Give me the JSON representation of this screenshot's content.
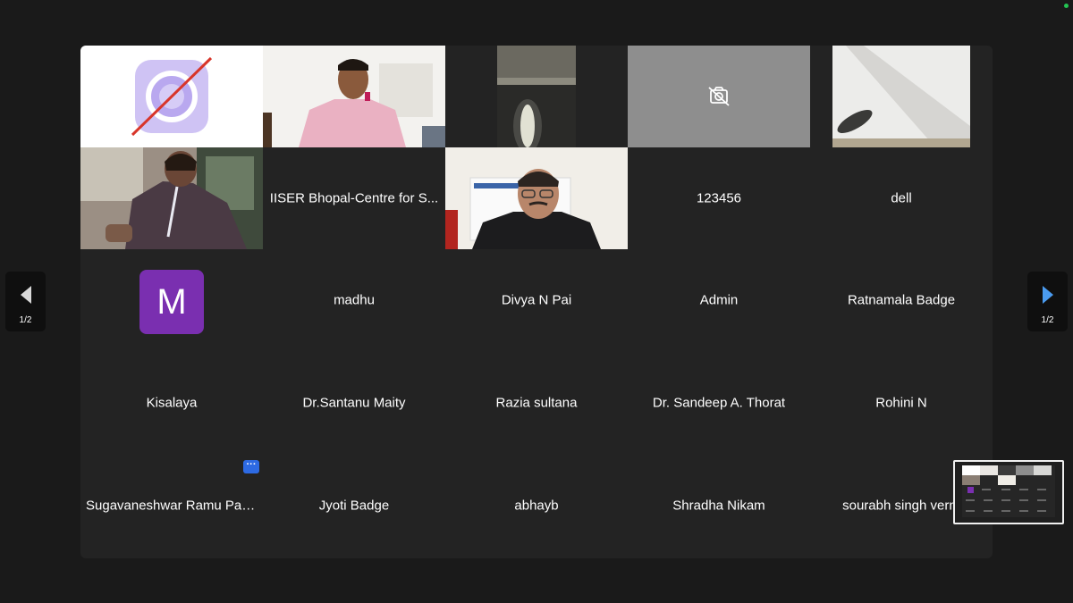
{
  "participants": [
    {
      "name": ""
    },
    {
      "name": ""
    },
    {
      "name": ""
    },
    {
      "name": ""
    },
    {
      "name": ""
    },
    {
      "name": ""
    },
    {
      "name": "IISER Bhopal-Centre for S..."
    },
    {
      "name": ""
    },
    {
      "name": "123456"
    },
    {
      "name": "dell"
    },
    {
      "name": "",
      "avatar_letter": "M"
    },
    {
      "name": "madhu"
    },
    {
      "name": "Divya N Pai"
    },
    {
      "name": "Admin"
    },
    {
      "name": "Ratnamala Badge"
    },
    {
      "name": "Kisalaya"
    },
    {
      "name": "Dr.Santanu Maity"
    },
    {
      "name": "Razia sultana"
    },
    {
      "name": "Dr. Sandeep A. Thorat"
    },
    {
      "name": "Rohini N"
    },
    {
      "name": "Sugavaneshwar Ramu Pas..."
    },
    {
      "name": "Jyoti Badge"
    },
    {
      "name": "abhayb"
    },
    {
      "name": "Shradha Nikam"
    },
    {
      "name": "sourabh singh verm"
    }
  ],
  "pagination": {
    "prev_label": "1/2",
    "next_label": "1/2"
  },
  "more_button": {
    "label": "···"
  },
  "colors": {
    "avatar_purple": "#7a2fb0",
    "accent_blue": "#2d6ae3",
    "nav_arrow_blue": "#4a9bf0",
    "status_green": "#23c552"
  }
}
